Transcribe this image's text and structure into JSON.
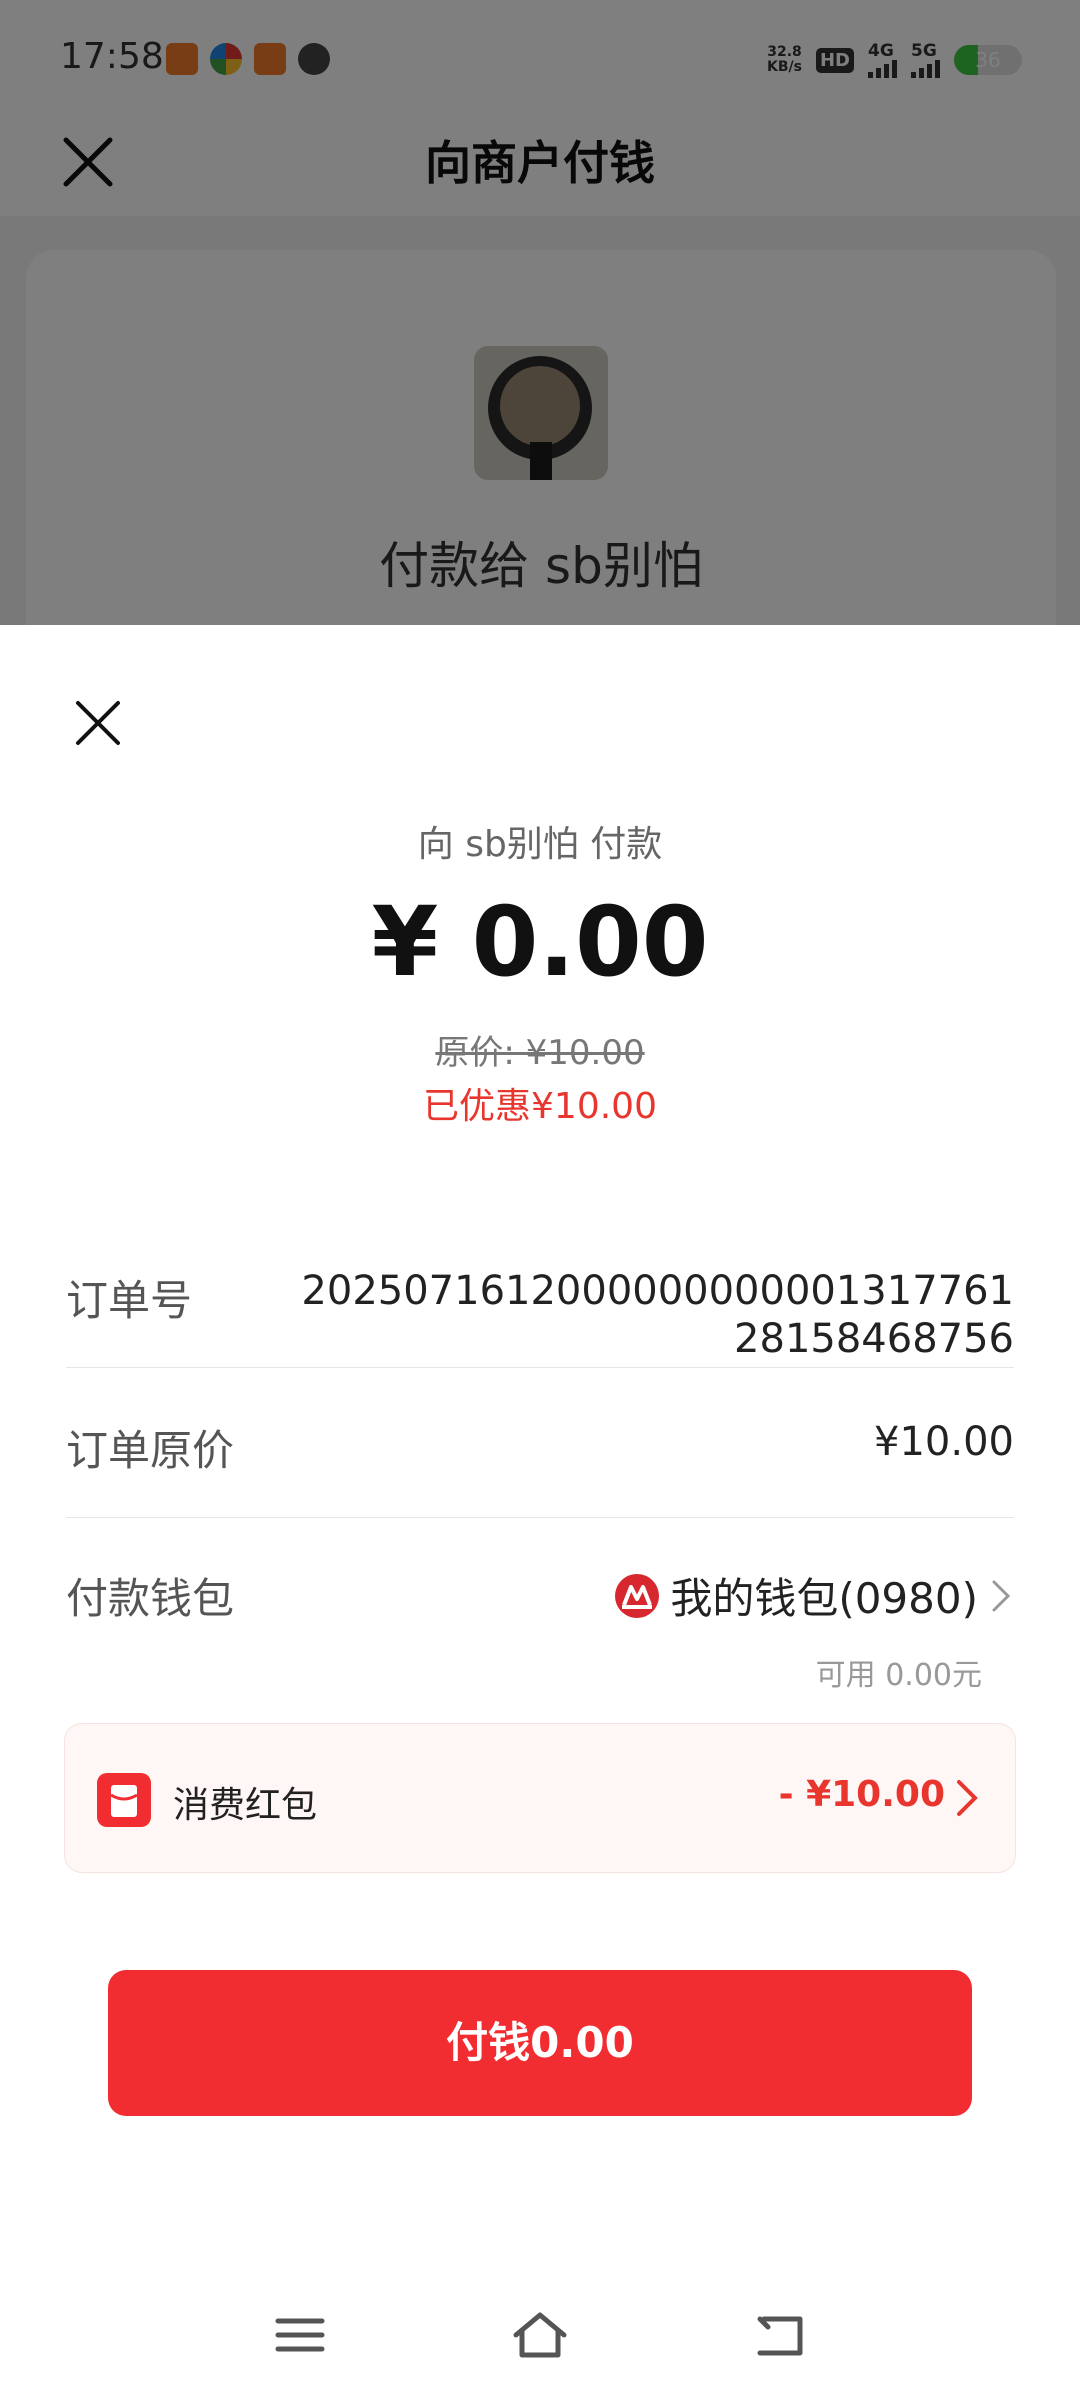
{
  "status_bar": {
    "time": "17:58",
    "net_speed_value": "32.8",
    "net_speed_unit": "KB/s",
    "hd_label": "HD",
    "signal_1": "4G",
    "signal_2": "5G",
    "battery": "36",
    "battery_level": 0.36
  },
  "header": {
    "title": "向商户付钱"
  },
  "merchant": {
    "name": "付款给 sb别怕"
  },
  "sheet": {
    "pay_to": "向 sb别怕 付款",
    "amount": "¥ 0.00",
    "original_price": "原价: ¥10.00",
    "discount": "已优惠¥10.00",
    "order_number_label": "订单号",
    "order_number": "2025071612000000000001317761 28158468756",
    "order_price_label": "订单原价",
    "order_price": "¥10.00",
    "wallet_label": "付款钱包",
    "wallet_name": "我的钱包(0980)",
    "available": "可用 0.00元",
    "coupon_label": "消费红包",
    "coupon_amount": "- ¥10.00",
    "pay_button": "付钱0.00"
  },
  "colors": {
    "accent_red": "#f22d31",
    "discount_red": "#e8352e"
  },
  "icons": [
    "close-icon",
    "bank-logo-icon",
    "chevron-right-icon",
    "red-packet-icon",
    "menu-icon",
    "home-icon",
    "back-icon"
  ]
}
